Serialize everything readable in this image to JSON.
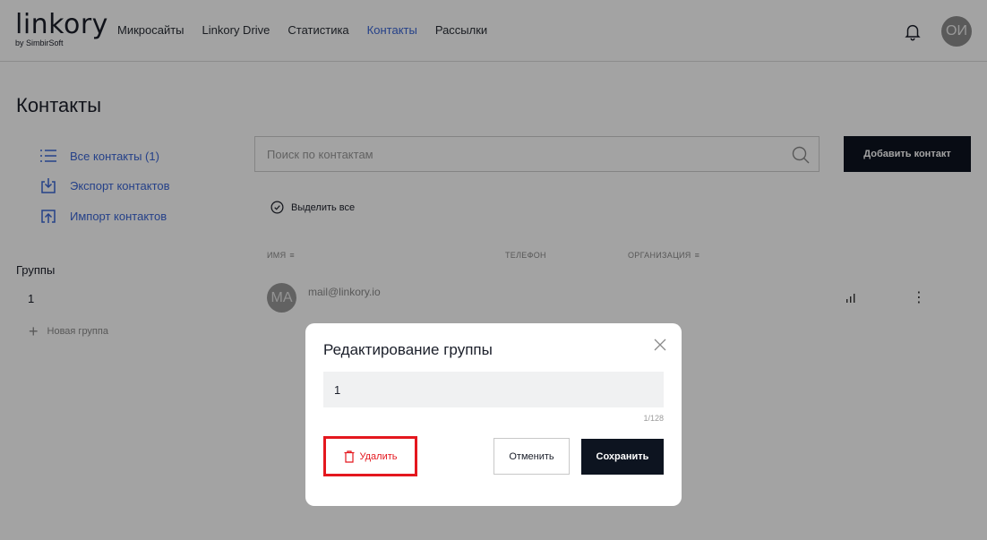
{
  "header": {
    "logo": "linkory",
    "logo_sub": "by SimbirSoft",
    "nav": [
      {
        "label": "Микросайты"
      },
      {
        "label": "Linkory Drive"
      },
      {
        "label": "Статистика"
      },
      {
        "label": "Контакты"
      },
      {
        "label": "Рассылки"
      }
    ],
    "active_nav": "Контакты",
    "avatar_initials": "ОИ"
  },
  "page": {
    "title": "Контакты"
  },
  "sidebar": {
    "links": [
      {
        "label": "Все контакты (1)",
        "icon": "list-icon"
      },
      {
        "label": "Экспорт контактов",
        "icon": "export-icon"
      },
      {
        "label": "Импорт контактов",
        "icon": "import-icon"
      }
    ],
    "groups_title": "Группы",
    "groups": [
      {
        "label": "1"
      }
    ],
    "new_group_label": "Новая группа"
  },
  "search": {
    "placeholder": "Поиск по контактам"
  },
  "toolbar": {
    "add_contact_label": "Добавить контакт",
    "select_all_label": "Выделить все"
  },
  "table": {
    "columns": [
      {
        "label": "ИМЯ",
        "sortable": true
      },
      {
        "label": "ТЕЛЕФОН",
        "sortable": false
      },
      {
        "label": "ОРГАНИЗАЦИЯ",
        "sortable": true
      }
    ],
    "rows": [
      {
        "avatar_initials": "MA",
        "email": "mail@linkory.io"
      }
    ]
  },
  "modal": {
    "title": "Редактирование группы",
    "input_value": "1",
    "counter": "1/128",
    "delete_label": "Удалить",
    "cancel_label": "Отменить",
    "save_label": "Сохранить"
  },
  "colors": {
    "accent": "#3b66d6",
    "dark": "#0d1420",
    "danger": "#e4171e"
  }
}
